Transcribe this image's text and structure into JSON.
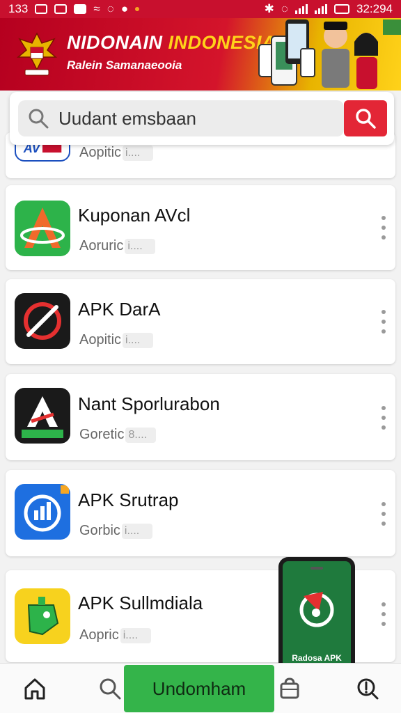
{
  "status_bar": {
    "left_text": "133",
    "time": "32:294"
  },
  "banner": {
    "title_part1": "NIDONAIN",
    "title_part2": "INDONESIA",
    "subtitle": "Ralein Samanaeooia"
  },
  "search": {
    "value": "Uudant emsbaan"
  },
  "apps": [
    {
      "name": "",
      "meta": "Aopitic",
      "meta_tail": "i....",
      "icon": "vpn-app-icon"
    },
    {
      "name": "Kuponan AVcl",
      "meta": "Aoruric",
      "meta_tail": "i....",
      "icon": "a-letter-app-icon"
    },
    {
      "name": "APK DarA",
      "meta": "Aopitic",
      "meta_tail": "i....",
      "icon": "no-sign-app-icon"
    },
    {
      "name": "Nant Sporlurabon",
      "meta": "Goretic",
      "meta_tail": "8....",
      "icon": "a-shield-app-icon"
    },
    {
      "name": "APK Srutrap",
      "meta": "Gorbic",
      "meta_tail": "i....",
      "icon": "chart-app-icon"
    },
    {
      "name": "APK Sullmdiala",
      "meta": "Aopric",
      "meta_tail": "i....",
      "icon": "green-tag-app-icon"
    }
  ],
  "promo_phone": {
    "label": "Radosa APK"
  },
  "bottom_nav": {
    "primary_label": "Undomham"
  },
  "colors": {
    "brand_red": "#c8102e",
    "accent_yellow": "#ffd21a",
    "search_button": "#e32636",
    "primary_green": "#34b44a"
  }
}
